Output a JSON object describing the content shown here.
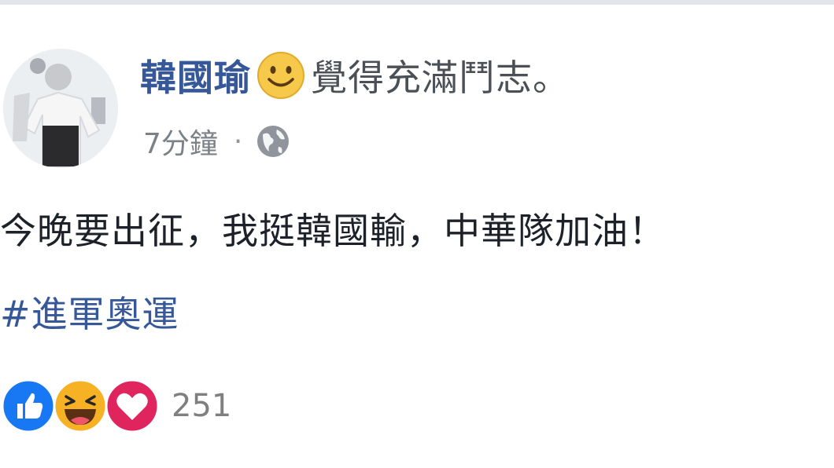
{
  "post": {
    "author": {
      "name": "韓國瑜",
      "feeling_icon": "smiley-face-icon",
      "feeling_text": "覺得充滿鬥志。"
    },
    "meta": {
      "timestamp": "7分鐘",
      "separator": "·",
      "privacy_icon": "globe-icon"
    },
    "body_text": "今晚要出征，我挺韓國輸，中華隊加油！",
    "hashtag": "#進軍奧運",
    "reactions": {
      "icons": [
        "like-icon",
        "haha-icon",
        "love-icon"
      ],
      "count": "251"
    }
  },
  "colors": {
    "link_blue": "#365899",
    "text": "#1d2129",
    "muted": "#90949c",
    "like_blue": "#1877f2",
    "love_red": "#e0245e",
    "haha_yellow": "#f7b125"
  }
}
